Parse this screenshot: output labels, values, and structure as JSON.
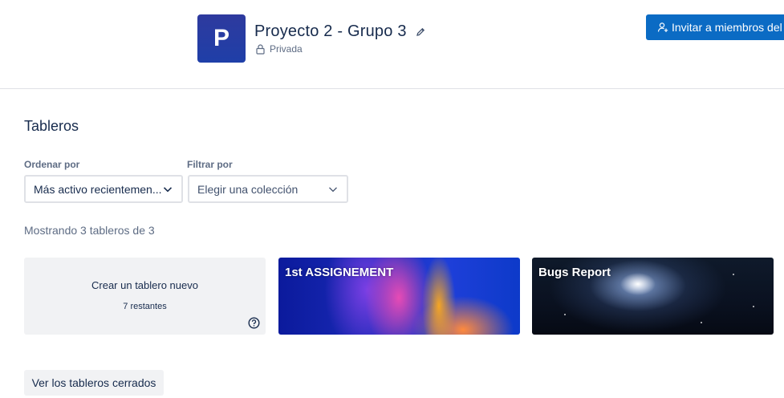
{
  "workspace": {
    "avatar_letter": "P",
    "title": "Proyecto 2 - Grupo 3",
    "privacy": "Privada",
    "invite_label": "Invitar a miembros del"
  },
  "boards_section": {
    "title": "Tableros",
    "sort": {
      "label": "Ordenar por",
      "value": "Más activo recientemen..."
    },
    "filter": {
      "label": "Filtrar por",
      "value": "Elegir una colección"
    },
    "showing_text": "Mostrando 3 tableros de 3",
    "create": {
      "title": "Crear un tablero nuevo",
      "remaining": "7 restantes"
    },
    "boards": [
      {
        "name": "1st ASSIGNEMENT"
      },
      {
        "name": "Bugs Report"
      }
    ],
    "closed_boards_label": "Ver los tableros cerrados"
  },
  "colors": {
    "accent": "#0b6bc4",
    "workspace_avatar": "#2e3a9e",
    "tile_bg": "#f1f2f4"
  },
  "icons": {
    "edit": "pencil-icon",
    "privacy": "lock-icon",
    "invite": "add-person-icon",
    "select": "chevron-down-icon",
    "help": "question-circle-icon"
  }
}
